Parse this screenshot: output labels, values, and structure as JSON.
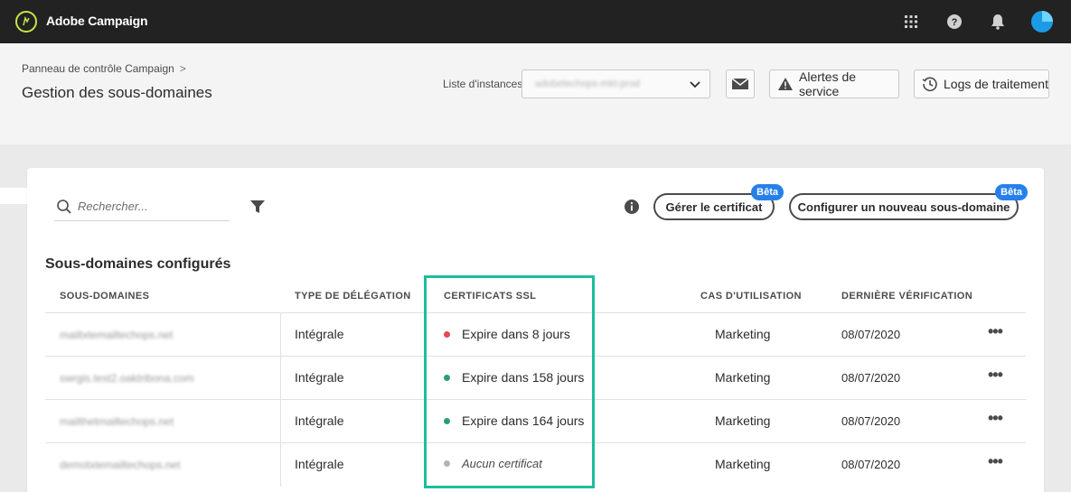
{
  "app": {
    "title": "Adobe Campaign",
    "brand_color": "#c6e646",
    "icons": [
      "apps-grid-icon",
      "help-icon",
      "bell-icon"
    ]
  },
  "header": {
    "breadcrumb": "Panneau de contrôle Campaign",
    "breadcrumb_chevron": ">",
    "page_title": "Gestion des sous-domaines",
    "instance_label": "Liste d'instances",
    "instance_value": "adobetechops-mkt-prod",
    "alerts_label": "Alertes de service",
    "logs_label": "Logs de traitement"
  },
  "toolbar": {
    "search_placeholder": "Rechercher...",
    "manage_cert_label": "Gérer le certificat",
    "new_subdomain_label": "Configurer un nouveau sous-domaine",
    "beta_label": "Bêta"
  },
  "table": {
    "title": "Sous-domaines configurés",
    "columns": [
      "SOUS-DOMAINES",
      "TYPE DE DÉLÉGATION",
      "CERTIFICATS SSL",
      "CAS D'UTILISATION",
      "DERNIÈRE VÉRIFICATION"
    ],
    "rows": [
      {
        "subdomain": "mailtxtemailtechops.net",
        "type": "Intégrale",
        "ssl": "Expire dans 8 jours",
        "ssl_status": "red",
        "use": "Marketing",
        "date": "08/07/2020",
        "more": "•••"
      },
      {
        "subdomain": "swrgis.test2.oaktribona.com",
        "type": "Intégrale",
        "ssl": "Expire dans 158 jours",
        "ssl_status": "green",
        "use": "Marketing",
        "date": "08/07/2020",
        "more": "•••"
      },
      {
        "subdomain": "mailthetmailtechops.net",
        "type": "Intégrale",
        "ssl": "Expire dans 164 jours",
        "ssl_status": "green",
        "use": "Marketing",
        "date": "08/07/2020",
        "more": "•••"
      },
      {
        "subdomain": "demotxtemailtechops.net",
        "type": "Intégrale",
        "ssl": "Aucun certificat",
        "ssl_status": "none",
        "use": "Marketing",
        "date": "08/07/2020",
        "more": "•••"
      }
    ]
  },
  "colors": {
    "status_red": "#e34850",
    "status_green": "#2d9d78",
    "status_none": "#b3b3b3",
    "highlight": "#1dbd9d",
    "beta": "#2680eb"
  }
}
